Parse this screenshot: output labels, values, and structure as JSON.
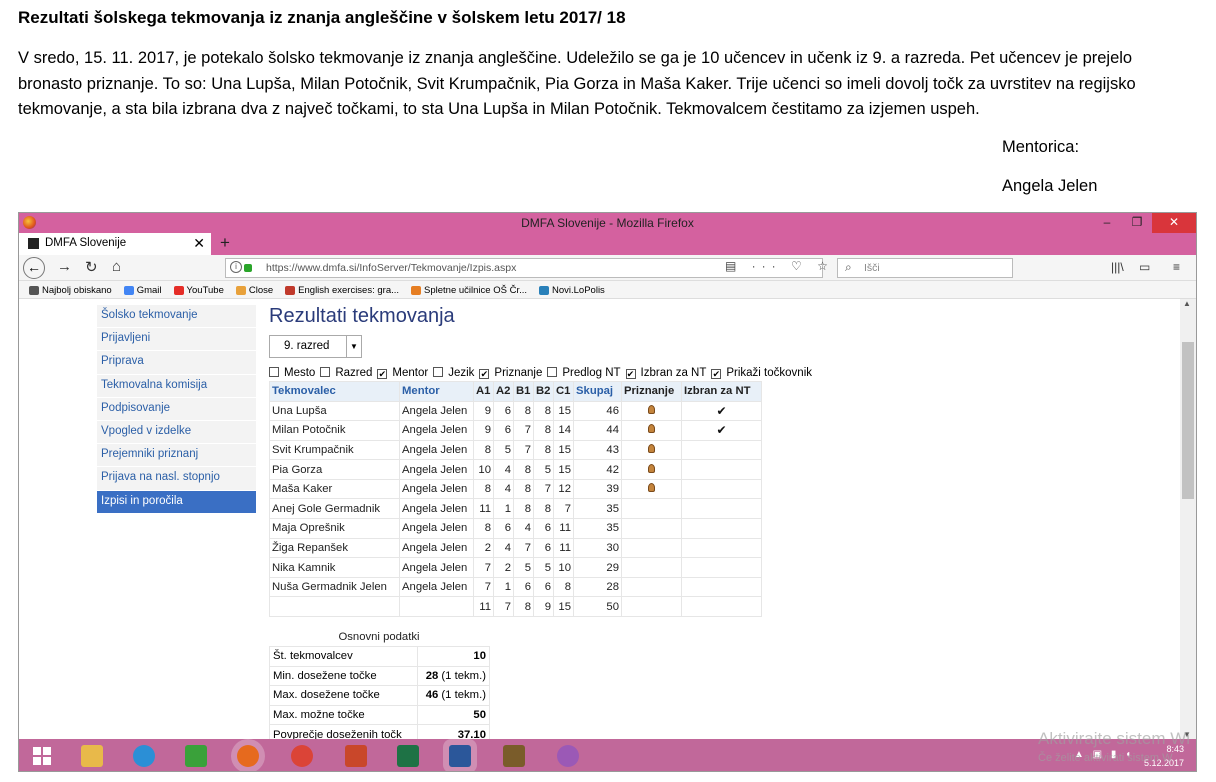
{
  "document": {
    "title": "Rezultati šolskega tekmovanja iz znanja angleščine v šolskem letu 2017/ 18",
    "paragraph": "V sredo, 15. 11. 2017, je potekalo šolsko tekmovanje iz znanja angleščine. Udeležilo se ga je 10 učencev in učenk iz 9. a razreda. Pet učencev je prejelo bronasto priznanje. To so: Una Lupša, Milan Potočnik, Svit Krumpačnik, Pia Gorza in Maša Kaker. Trije učenci so imeli dovolj točk za uvrstitev na regijsko tekmovanje, a sta bila izbrana dva z največ točkami, to sta Una Lupša in Milan Potočnik. Tekmovalcem čestitamo za izjemen uspeh.",
    "signature_label": "Mentorica:",
    "signature_name": "Angela Jelen"
  },
  "browser": {
    "window_title": "DMFA Slovenije - Mozilla Firefox",
    "tab_title": "DMFA Slovenije",
    "url": "https://www.dmfa.si/InfoServer/Tekmovanje/Izpis.aspx",
    "search_placeholder": "Išči",
    "bookmarks": [
      "Najbolj obiskano",
      "Gmail",
      "YouTube",
      "Close",
      "English exercises: gra...",
      "Spletne učilnice OŠ Čr...",
      "Novi.LoPolis"
    ]
  },
  "sidebar": {
    "items": [
      {
        "label": "Šolsko tekmovanje",
        "active": false
      },
      {
        "label": "Prijavljeni",
        "active": false
      },
      {
        "label": "Priprava",
        "active": false
      },
      {
        "label": "Tekmovalna komisija",
        "active": false
      },
      {
        "label": "Podpisovanje",
        "active": false
      },
      {
        "label": "Vpogled v izdelke",
        "active": false
      },
      {
        "label": "Prejemniki priznanj",
        "active": false
      },
      {
        "label": "Prijava na nasl. stopnjo",
        "active": false
      },
      {
        "label": "Izpisi in poročila",
        "active": true
      }
    ]
  },
  "main": {
    "title": "Rezultati tekmovanja",
    "class_select": "9. razred",
    "filters": [
      {
        "label": "Mesto",
        "checked": false
      },
      {
        "label": "Razred",
        "checked": false
      },
      {
        "label": "Mentor",
        "checked": true
      },
      {
        "label": "Jezik",
        "checked": false
      },
      {
        "label": "Priznanje",
        "checked": true
      },
      {
        "label": "Predlog NT",
        "checked": false
      },
      {
        "label": "Izbran za NT",
        "checked": true
      },
      {
        "label": "Prikaži točkovnik",
        "checked": true
      }
    ],
    "table": {
      "headers": [
        "Tekmovalec",
        "Mentor",
        "A1",
        "A2",
        "B1",
        "B2",
        "C1",
        "Skupaj",
        "Priznanje",
        "Izbran za NT"
      ],
      "rows": [
        {
          "name": "Una Lupša",
          "mentor": "Angela Jelen",
          "a1": "9",
          "a2": "6",
          "b1": "8",
          "b2": "8",
          "c1": "15",
          "total": "46",
          "award": true,
          "selected": true
        },
        {
          "name": "Milan Potočnik",
          "mentor": "Angela Jelen",
          "a1": "9",
          "a2": "6",
          "b1": "7",
          "b2": "8",
          "c1": "14",
          "total": "44",
          "award": true,
          "selected": true
        },
        {
          "name": "Svit Krumpačnik",
          "mentor": "Angela Jelen",
          "a1": "8",
          "a2": "5",
          "b1": "7",
          "b2": "8",
          "c1": "15",
          "total": "43",
          "award": true,
          "selected": false
        },
        {
          "name": "Pia Gorza",
          "mentor": "Angela Jelen",
          "a1": "10",
          "a2": "4",
          "b1": "8",
          "b2": "5",
          "c1": "15",
          "total": "42",
          "award": true,
          "selected": false
        },
        {
          "name": "Maša Kaker",
          "mentor": "Angela Jelen",
          "a1": "8",
          "a2": "4",
          "b1": "8",
          "b2": "7",
          "c1": "12",
          "total": "39",
          "award": true,
          "selected": false
        },
        {
          "name": "Anej Gole Germadnik",
          "mentor": "Angela Jelen",
          "a1": "11",
          "a2": "1",
          "b1": "8",
          "b2": "8",
          "c1": "7",
          "total": "35",
          "award": false,
          "selected": false
        },
        {
          "name": "Maja Oprešnik",
          "mentor": "Angela Jelen",
          "a1": "8",
          "a2": "6",
          "b1": "4",
          "b2": "6",
          "c1": "11",
          "total": "35",
          "award": false,
          "selected": false
        },
        {
          "name": "Žiga Repanšek",
          "mentor": "Angela Jelen",
          "a1": "2",
          "a2": "4",
          "b1": "7",
          "b2": "6",
          "c1": "11",
          "total": "30",
          "award": false,
          "selected": false
        },
        {
          "name": "Nika Kamnik",
          "mentor": "Angela Jelen",
          "a1": "7",
          "a2": "2",
          "b1": "5",
          "b2": "5",
          "c1": "10",
          "total": "29",
          "award": false,
          "selected": false
        },
        {
          "name": "Nuša Germadnik Jelen",
          "mentor": "Angela Jelen",
          "a1": "7",
          "a2": "1",
          "b1": "6",
          "b2": "6",
          "c1": "8",
          "total": "28",
          "award": false,
          "selected": false
        }
      ],
      "max_row": {
        "a1": "11",
        "a2": "7",
        "b1": "8",
        "b2": "9",
        "c1": "15",
        "total": "50"
      }
    },
    "basic": {
      "title": "Osnovni podatki",
      "rows": [
        {
          "label": "Št. tekmovalcev",
          "value": "10",
          "suffix": ""
        },
        {
          "label": "Min. dosežene točke",
          "value": "28",
          "suffix": "(1 tekm.)"
        },
        {
          "label": "Max. dosežene točke",
          "value": "46",
          "suffix": "(1 tekm.)"
        },
        {
          "label": "Max. možne točke",
          "value": "50",
          "suffix": ""
        },
        {
          "label": "Povprečje doseženih točk",
          "value": "37.10",
          "suffix": ""
        }
      ]
    }
  },
  "taskbar": {
    "time": "8:43",
    "date": "5.12.2017"
  },
  "watermark": {
    "line1": "Aktivirajte sistem Wi",
    "line2": "Če želite aktivirati sistem W"
  },
  "colors": {
    "titlebar": "#d4619f",
    "taskbar": "#c1689a",
    "link": "#2b5fa7",
    "active_nav": "#3a6fc4"
  }
}
